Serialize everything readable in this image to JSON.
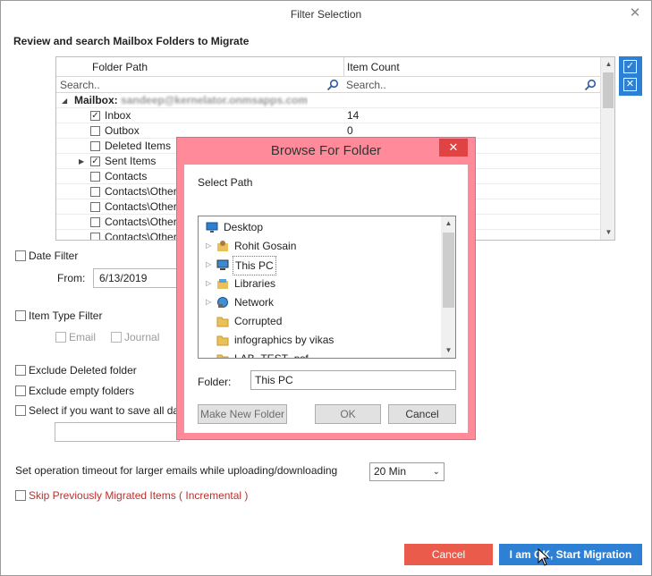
{
  "window": {
    "title": "Filter Selection",
    "close_glyph": "✕"
  },
  "main": {
    "section_title": "Review and search Mailbox Folders to Migrate",
    "grid": {
      "columns": [
        "Folder Path",
        "Item Count"
      ],
      "search_placeholder_path": "Search..",
      "search_placeholder_count": "Search..",
      "mailbox_label": "Mailbox:",
      "mailbox_address": "sandeep@kernelator.onmsapps.com",
      "rows": [
        {
          "label": "Inbox",
          "count": "14",
          "checked": true
        },
        {
          "label": "Outbox",
          "count": "0",
          "checked": false
        },
        {
          "label": "Deleted Items",
          "count": "",
          "checked": false
        },
        {
          "label": "Sent Items",
          "count": "",
          "checked": true,
          "expandable": true
        },
        {
          "label": "Contacts",
          "count": "",
          "checked": false
        },
        {
          "label": "Contacts\\Other C",
          "count": "",
          "checked": false
        },
        {
          "label": "Contacts\\Other C",
          "count": "",
          "checked": false
        },
        {
          "label": "Contacts\\Other C",
          "count": "",
          "checked": false
        },
        {
          "label": "Contacts\\Other C",
          "count": "",
          "checked": false
        }
      ]
    },
    "side_buttons": {
      "select_all_glyph": "✓",
      "clear_glyph": "✕"
    },
    "date_filter": {
      "label": "Date Filter",
      "from_label": "From:",
      "from_value": "6/13/2019"
    },
    "item_type_filter": {
      "label": "Item Type Filter",
      "options": [
        "Email",
        "Journal"
      ]
    },
    "exclude_deleted": "Exclude Deleted folder",
    "exclude_empty": "Exclude empty folders",
    "save_all_data": "Select if you want to save all dat",
    "timeout_label": "Set operation timeout for larger emails while uploading/downloading",
    "timeout_value": "20 Min",
    "skip_migrated": "Skip Previously Migrated Items ( Incremental )",
    "cancel_label": "Cancel",
    "start_label": "I am OK, Start Migration"
  },
  "dialog": {
    "title": "Browse For Folder",
    "close_glyph": "✕",
    "select_path_label": "Select Path",
    "tree": [
      {
        "label": "Desktop",
        "icon": "desktop-icon"
      },
      {
        "label": "Rohit Gosain",
        "icon": "user-folder-icon"
      },
      {
        "label": "This PC",
        "icon": "computer-icon",
        "selected": true
      },
      {
        "label": "Libraries",
        "icon": "libraries-icon"
      },
      {
        "label": "Network",
        "icon": "network-icon"
      },
      {
        "label": "Corrupted",
        "icon": "folder-icon"
      },
      {
        "label": "infographics by vikas",
        "icon": "folder-icon"
      },
      {
        "label": "LAB_TEST_psf",
        "icon": "folder-icon"
      }
    ],
    "folder_label": "Folder:",
    "folder_value": "This PC",
    "make_new_folder": "Make New Folder",
    "ok": "OK",
    "cancel": "Cancel"
  },
  "colors": {
    "accent_blue": "#2e80d4",
    "cancel_red": "#ea5b4b",
    "dialog_frame": "#ff8b9a",
    "skip_text": "#b8312f"
  }
}
